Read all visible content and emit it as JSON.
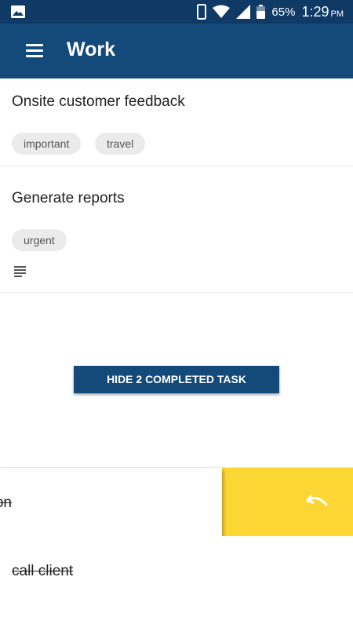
{
  "status_bar": {
    "notification_icon": "image-icon",
    "battery_percent": "65%",
    "time": "1:29",
    "ampm": "PM"
  },
  "app_bar": {
    "menu_icon": "hamburger-menu-icon",
    "title": "Work"
  },
  "tasks": [
    {
      "title": "Onsite customer feedback",
      "tags": [
        "important",
        "travel"
      ],
      "has_note": false
    },
    {
      "title": "Generate reports",
      "tags": [
        "urgent"
      ],
      "has_note": true
    }
  ],
  "hide_completed_button": "HIDE 2 COMPLETED TASK",
  "completed_tasks": [
    {
      "title": "on",
      "swiped": true
    },
    {
      "title": "call client",
      "swiped": false
    }
  ],
  "colors": {
    "status_bar": "#0f3a66",
    "app_bar": "#134a7a",
    "button": "#134a7a",
    "swipe_background": "#fcd734"
  }
}
